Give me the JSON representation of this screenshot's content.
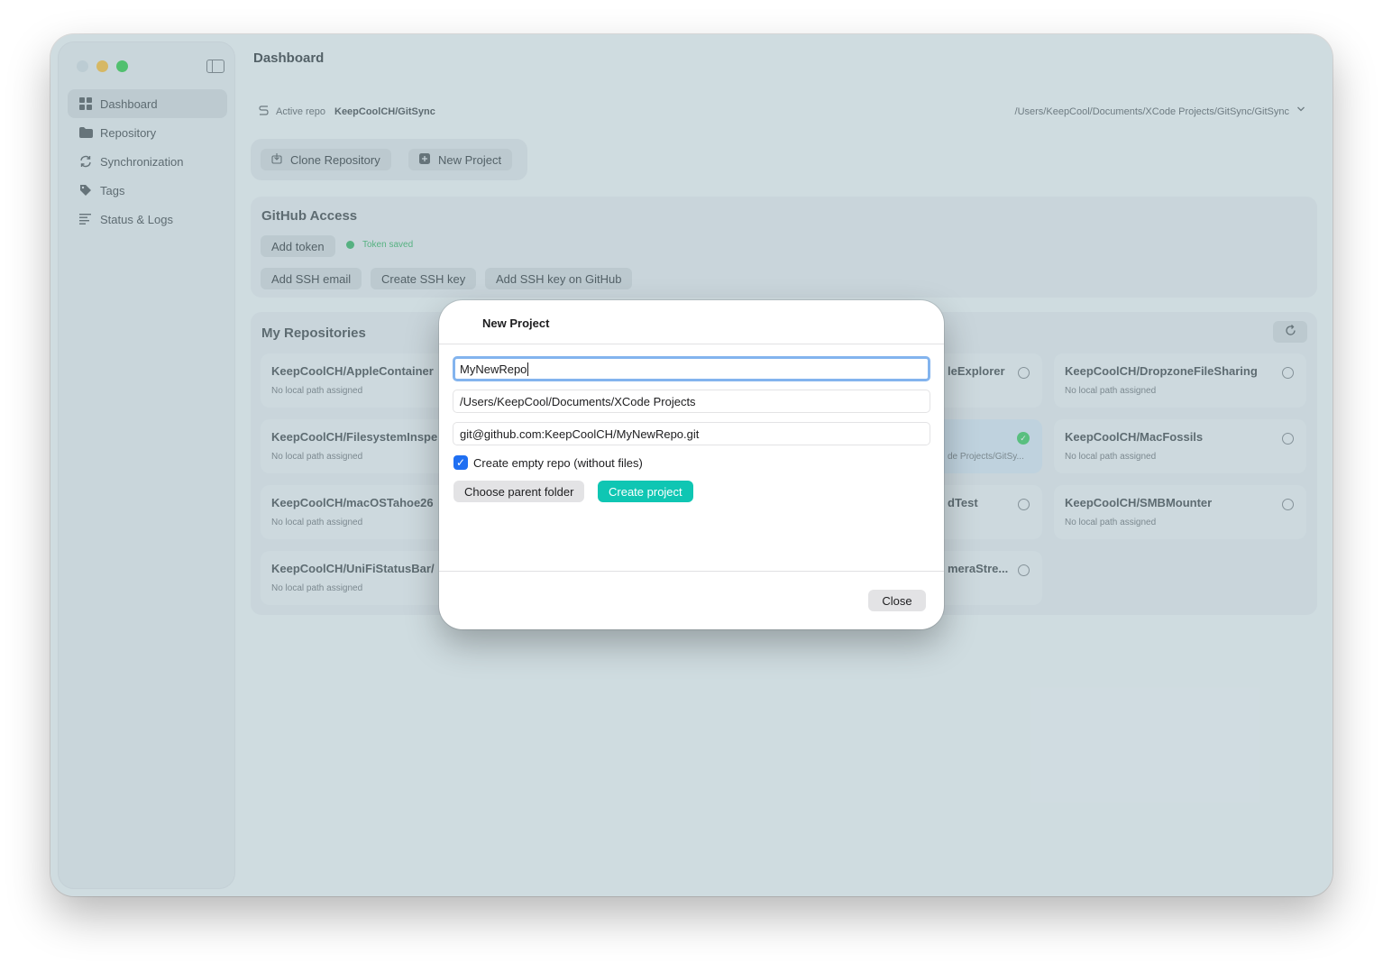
{
  "window": {
    "title": "Dashboard"
  },
  "sidebar": {
    "items": [
      {
        "label": "Dashboard",
        "icon": "grid-icon",
        "active": true
      },
      {
        "label": "Repository",
        "icon": "folder-icon",
        "active": false
      },
      {
        "label": "Synchronization",
        "icon": "sync-icon",
        "active": false
      },
      {
        "label": "Tags",
        "icon": "tag-icon",
        "active": false
      },
      {
        "label": "Status & Logs",
        "icon": "list-icon",
        "active": false
      }
    ]
  },
  "active_repo": {
    "label": "Active repo",
    "name": "KeepCoolCH/GitSync",
    "path": "/Users/KeepCool/Documents/XCode Projects/GitSync/GitSync"
  },
  "actions": {
    "clone_label": "Clone Repository",
    "new_project_label": "New Project"
  },
  "github_access": {
    "title": "GitHub Access",
    "add_token_label": "Add token",
    "token_status": "Token saved",
    "add_ssh_email_label": "Add SSH email",
    "create_ssh_key_label": "Create SSH key",
    "add_ssh_key_github_label": "Add SSH key on GitHub"
  },
  "repositories": {
    "title": "My Repositories",
    "tiles": [
      {
        "name": "KeepCoolCH/AppleContainer",
        "sub": "No local path assigned"
      },
      {
        "name": "KeepCoolCH/FilesystemInspe",
        "sub": "No local path assigned"
      },
      {
        "name": "KeepCoolCH/macOSTahoe26",
        "sub": "No local path assigned"
      },
      {
        "name": "KeepCoolCH/UniFiStatusBar/",
        "sub": "No local path assigned"
      },
      {
        "name": "leExplorer",
        "sub": ""
      },
      {
        "name": "",
        "sub": "de Projects/GitSy..."
      },
      {
        "name": "dTest",
        "sub": ""
      },
      {
        "name": "meraStre...",
        "sub": ""
      },
      {
        "name": "KeepCoolCH/DropzoneFileSharing",
        "sub": "No local path assigned"
      },
      {
        "name": "KeepCoolCH/MacFossils",
        "sub": "No local path assigned"
      },
      {
        "name": "KeepCoolCH/SMBMounter",
        "sub": "No local path assigned"
      }
    ]
  },
  "modal": {
    "title": "New Project",
    "name_value": "MyNewRepo",
    "parent_path_value": "/Users/KeepCool/Documents/XCode Projects",
    "remote_url_value": "git@github.com:KeepCoolCH/MyNewRepo.git",
    "empty_repo_label": "Create empty repo (without files)",
    "empty_repo_checked": true,
    "choose_folder_label": "Choose parent folder",
    "create_label": "Create project",
    "close_label": "Close"
  },
  "colors": {
    "accent": "#0fc6b3",
    "checkbox": "#1f6ff2",
    "token_ok": "#2fb15d"
  }
}
